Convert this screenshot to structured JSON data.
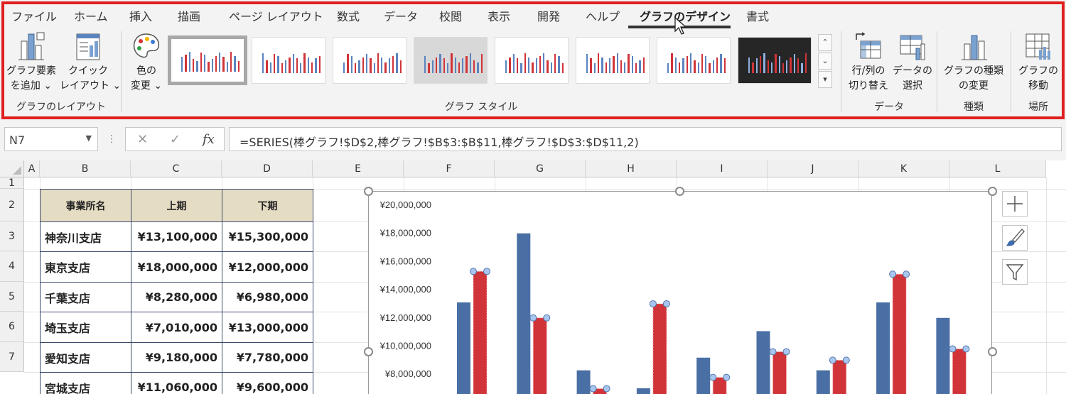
{
  "ribbon": {
    "tabs": [
      {
        "label": "ファイル",
        "active": false
      },
      {
        "label": "ホーム",
        "active": false
      },
      {
        "label": "挿入",
        "active": false
      },
      {
        "label": "描画",
        "active": false
      },
      {
        "label": "ページ レイアウト",
        "active": false
      },
      {
        "label": "数式",
        "active": false
      },
      {
        "label": "データ",
        "active": false
      },
      {
        "label": "校閲",
        "active": false
      },
      {
        "label": "表示",
        "active": false
      },
      {
        "label": "開発",
        "active": false
      },
      {
        "label": "ヘルプ",
        "active": false
      },
      {
        "label": "グラフのデザイン",
        "active": true
      },
      {
        "label": "書式",
        "active": false
      }
    ],
    "groups": {
      "layout": {
        "label": "グラフのレイアウト",
        "add_element": {
          "line1": "グラフ要素",
          "line2": "を追加 ⌄",
          "icon": "add-chart-element-icon"
        },
        "quick_layout": {
          "line1": "クイック",
          "line2": "レイアウト ⌄",
          "icon": "quick-layout-icon"
        }
      },
      "styles": {
        "label": "グラフ スタイル",
        "change_colors": {
          "line1": "色の",
          "line2": "変更 ⌄",
          "icon": "palette-icon"
        },
        "style_count": 8,
        "selected_style": 1
      },
      "data": {
        "label": "データ",
        "switch_row_col": {
          "line1": "行/列の",
          "line2": "切り替え",
          "icon": "switch-row-column-icon"
        },
        "select_data": {
          "line1": "データの",
          "line2": "選択",
          "icon": "select-data-icon"
        }
      },
      "type": {
        "label": "種類",
        "change_type": {
          "line1": "グラフの種類",
          "line2": "の変更",
          "icon": "change-chart-type-icon"
        }
      },
      "location": {
        "label": "場所",
        "move_chart": {
          "line1": "グラフの",
          "line2": "移動",
          "icon": "move-chart-icon"
        }
      }
    }
  },
  "formula_bar": {
    "name_box": "N7",
    "formula": "=SERIES(棒グラフ!$D$2,棒グラフ!$B$3:$B$11,棒グラフ!$D$3:$D$11,2)",
    "cancel": "✕",
    "enter": "✓",
    "fx": "fx"
  },
  "sheet": {
    "columns": [
      "A",
      "B",
      "C",
      "D",
      "E",
      "F",
      "G",
      "H",
      "I",
      "J",
      "K",
      "L"
    ],
    "rows": [
      "1",
      "2",
      "3",
      "4",
      "5",
      "6",
      "7"
    ],
    "table": {
      "headers": [
        "事業所名",
        "上期",
        "下期"
      ],
      "rows": [
        [
          "神奈川支店",
          "¥13,100,000",
          "¥15,300,000"
        ],
        [
          "東京支店",
          "¥18,000,000",
          "¥12,000,000"
        ],
        [
          "千葉支店",
          "¥8,280,000",
          "¥6,980,000"
        ],
        [
          "埼玉支店",
          "¥7,010,000",
          "¥13,000,000"
        ],
        [
          "愛知支店",
          "¥9,180,000",
          "¥7,780,000"
        ],
        [
          "宮城支店",
          "¥11,060,000",
          "¥9,600,000"
        ]
      ]
    }
  },
  "chart_data": {
    "type": "bar",
    "series": [
      {
        "values": [
          13100000,
          18000000,
          8280000,
          7010000,
          9180000,
          11060000,
          8280000,
          13100000,
          12000000
        ],
        "color": "#4a6fa5"
      },
      {
        "values": [
          15300000,
          12000000,
          6980000,
          13000000,
          7780000,
          9600000,
          9000000,
          15100000,
          9800000
        ],
        "color": "#d13438",
        "selected": true
      }
    ],
    "y_tick_labels": [
      "¥20,000,000",
      "¥18,000,000",
      "¥16,000,000",
      "¥14,000,000",
      "¥12,000,000",
      "¥10,000,000",
      "¥8,000,000"
    ],
    "ylim": [
      0,
      20000000
    ],
    "grid": false
  },
  "chart_side_buttons": {
    "add": "plus-icon",
    "style": "brush-icon",
    "filter": "filter-icon"
  }
}
